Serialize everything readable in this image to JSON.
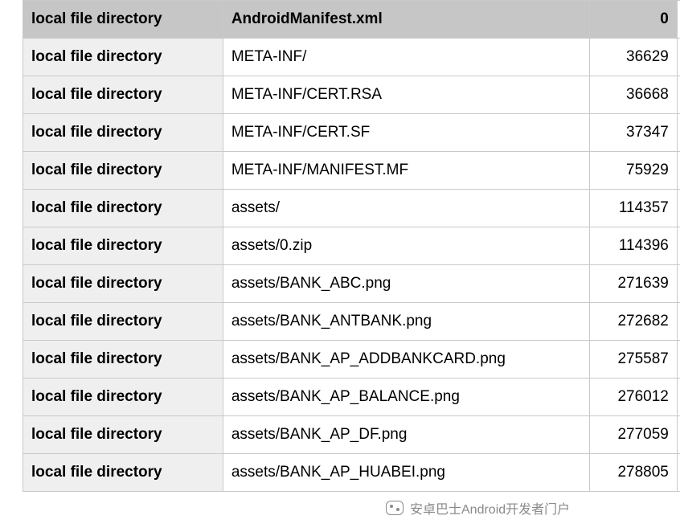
{
  "table": {
    "header": {
      "label": "local file directory",
      "path": "AndroidManifest.xml",
      "num": "0"
    },
    "rows": [
      {
        "label": "local file directory",
        "path": "META-INF/",
        "num": "36629"
      },
      {
        "label": "local file directory",
        "path": "META-INF/CERT.RSA",
        "num": "36668"
      },
      {
        "label": "local file directory",
        "path": "META-INF/CERT.SF",
        "num": "37347"
      },
      {
        "label": "local file directory",
        "path": "META-INF/MANIFEST.MF",
        "num": "75929"
      },
      {
        "label": "local file directory",
        "path": "assets/",
        "num": "114357"
      },
      {
        "label": "local file directory",
        "path": "assets/0.zip",
        "num": "114396"
      },
      {
        "label": "local file directory",
        "path": "assets/BANK_ABC.png",
        "num": "271639"
      },
      {
        "label": "local file directory",
        "path": "assets/BANK_ANTBANK.png",
        "num": "272682"
      },
      {
        "label": "local file directory",
        "path": "assets/BANK_AP_ADDBANKCARD.png",
        "num": "275587"
      },
      {
        "label": "local file directory",
        "path": "assets/BANK_AP_BALANCE.png",
        "num": "276012"
      },
      {
        "label": "local file directory",
        "path": "assets/BANK_AP_DF.png",
        "num": "277059"
      },
      {
        "label": "local file directory",
        "path": "assets/BANK_AP_HUABEI.png",
        "num": "278805"
      }
    ]
  },
  "watermark": {
    "text": "安卓巴士Android开发者门户"
  }
}
